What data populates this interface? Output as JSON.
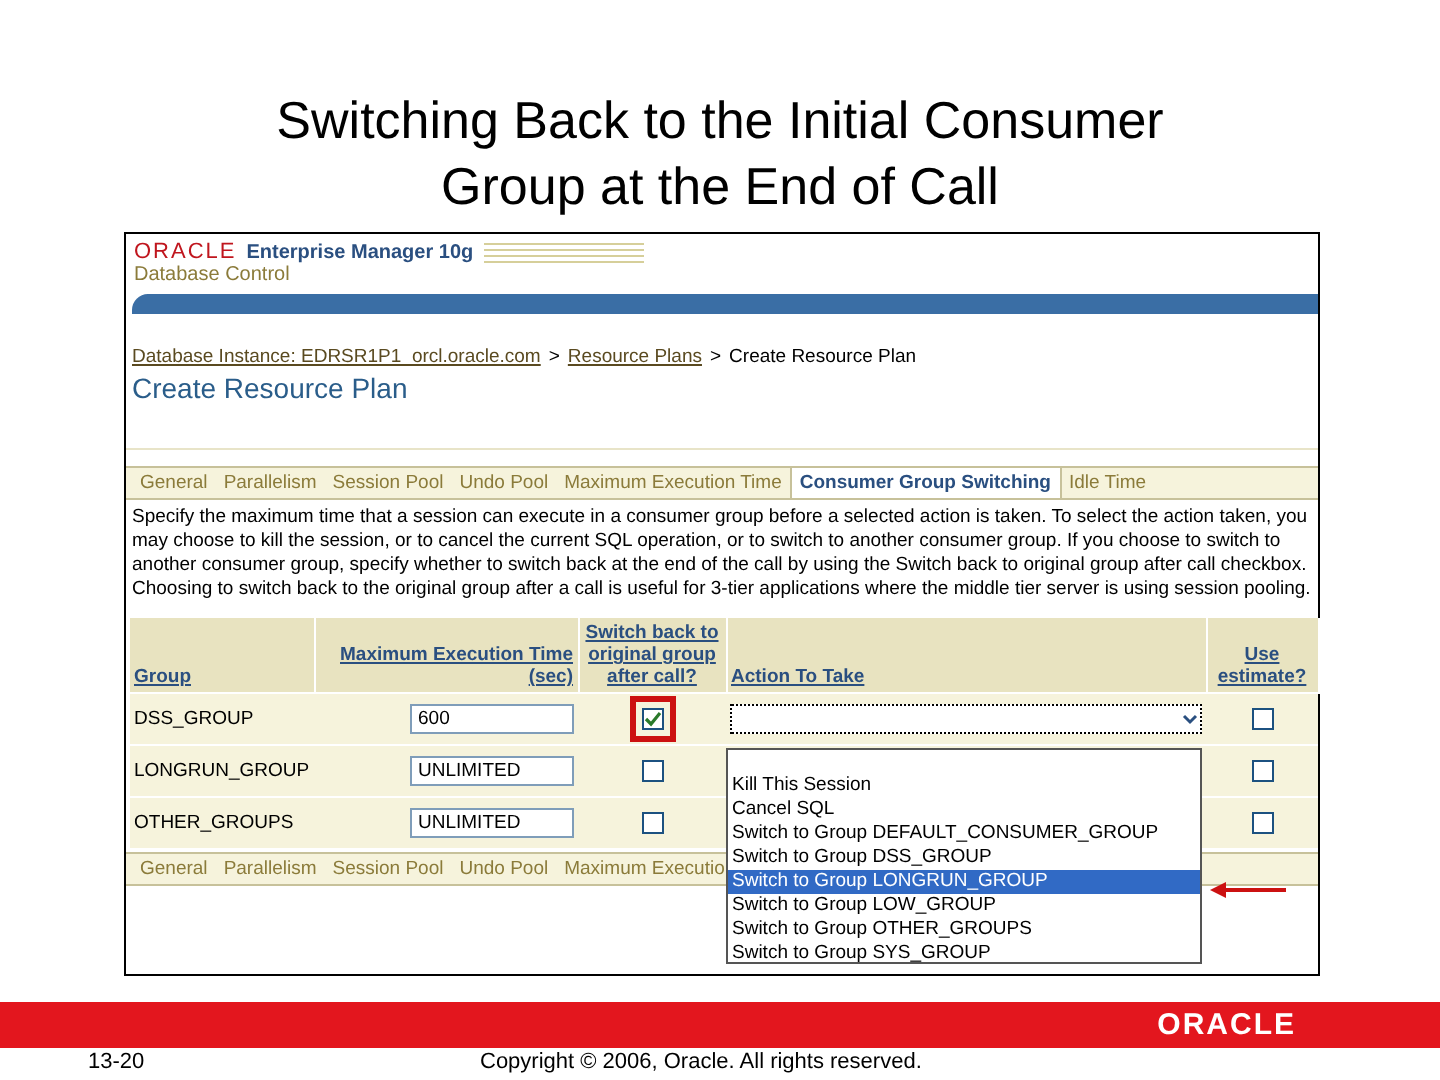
{
  "slide": {
    "title": "Switching Back to the Initial Consumer Group at the End of Call",
    "page_number": "13-20",
    "copyright": "Copyright © 2006, Oracle. All rights reserved.",
    "footer_logo": "ORACLE"
  },
  "app": {
    "brand": "ORACLE",
    "product": "Enterprise Manager 10g",
    "subtitle": "Database Control"
  },
  "breadcrumb": [
    {
      "label": "Database Instance: EDRSR1P1_orcl.oracle.com",
      "link": true
    },
    {
      "label": "Resource Plans",
      "link": true
    },
    {
      "label": "Create Resource Plan",
      "link": false
    }
  ],
  "breadcrumb_separator": ">",
  "page_title": "Create Resource Plan",
  "tabs": [
    {
      "label": "General",
      "selected": false
    },
    {
      "label": "Parallelism",
      "selected": false
    },
    {
      "label": "Session Pool",
      "selected": false
    },
    {
      "label": "Undo Pool",
      "selected": false
    },
    {
      "label": "Maximum Execution Time",
      "selected": false
    },
    {
      "label": "Consumer Group Switching",
      "selected": true
    },
    {
      "label": "Idle Time",
      "selected": false
    }
  ],
  "description": "Specify the maximum time that a session can execute in a consumer group before a selected action is taken. To select the action taken, you may choose to kill the session, or to cancel the current SQL operation, or to switch to another consumer group. If you choose to switch to another consumer group, specify whether to switch back at the end of the call by using the Switch back to original group after call checkbox. Choosing to switch back to the original group after a call is useful for 3-tier applications where the middle tier server is using session pooling.",
  "table": {
    "columns": [
      "Group",
      "Maximum Execution Time (sec)",
      "Switch back to original group after call?",
      "Action To Take",
      "Use estimate?"
    ],
    "rows": [
      {
        "group": "DSS_GROUP",
        "max_time": "600",
        "switch_back": true,
        "highlighted": true,
        "use_estimate": false
      },
      {
        "group": "LONGRUN_GROUP",
        "max_time": "UNLIMITED",
        "switch_back": false,
        "highlighted": false,
        "use_estimate": false
      },
      {
        "group": "OTHER_GROUPS",
        "max_time": "UNLIMITED",
        "switch_back": false,
        "highlighted": false,
        "use_estimate": false
      }
    ]
  },
  "dropdown": {
    "options": [
      {
        "label": "Kill This Session",
        "selected": false
      },
      {
        "label": "Cancel SQL",
        "selected": false
      },
      {
        "label": "Switch to Group DEFAULT_CONSUMER_GROUP",
        "selected": false
      },
      {
        "label": "Switch to Group DSS_GROUP",
        "selected": false
      },
      {
        "label": "Switch to Group LONGRUN_GROUP",
        "selected": true
      },
      {
        "label": "Switch to Group LOW_GROUP",
        "selected": false
      },
      {
        "label": "Switch to Group OTHER_GROUPS",
        "selected": false
      },
      {
        "label": "Switch to Group SYS_GROUP",
        "selected": false
      }
    ]
  },
  "bottom_tabs": [
    "General",
    "Parallelism",
    "Session Pool",
    "Undo Pool",
    "Maximum Executio"
  ]
}
